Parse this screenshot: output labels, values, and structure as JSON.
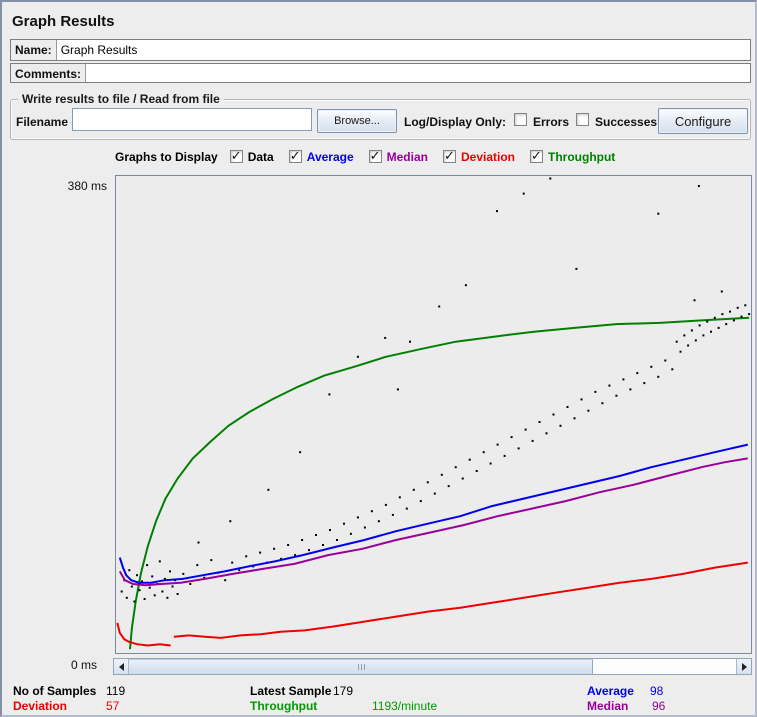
{
  "window": {
    "title": "Graph Results"
  },
  "name_field": {
    "label": "Name:",
    "value": "Graph Results"
  },
  "comments_field": {
    "label": "Comments:",
    "value": ""
  },
  "file_section": {
    "title": "Write results to file / Read from file",
    "filename_label": "Filename",
    "filename_value": "",
    "browse_label": "Browse...",
    "log_display_label": "Log/Display Only:",
    "errors_label": "Errors",
    "errors_checked": false,
    "successes_label": "Successes",
    "successes_checked": false,
    "configure_label": "Configure"
  },
  "graphs_to_display": {
    "label": "Graphs to Display",
    "items": [
      {
        "label": "Data",
        "color": "#000000",
        "checked": true
      },
      {
        "label": "Average",
        "color": "#0000ee",
        "checked": true
      },
      {
        "label": "Median",
        "color": "#990099",
        "checked": true
      },
      {
        "label": "Deviation",
        "color": "#ee0000",
        "checked": true
      },
      {
        "label": "Throughput",
        "color": "#008000",
        "checked": true
      }
    ]
  },
  "chart_data": {
    "type": "scatter+line",
    "y_unit": "ms",
    "ylim": [
      0,
      380
    ],
    "axis_labels": {
      "top": "380 ms",
      "bottom": "0 ms"
    },
    "plot_bg": "#ececec",
    "series": [
      {
        "name": "Throughput",
        "color": "#008000",
        "width": 2,
        "segments": [
          [
            [
              2.2,
              3
            ],
            [
              2.5,
              20
            ],
            [
              3.1,
              41
            ],
            [
              3.9,
              63
            ],
            [
              5.0,
              85
            ],
            [
              6.3,
              105
            ],
            [
              7.8,
              123
            ],
            [
              9.7,
              139
            ],
            [
              12.1,
              155
            ],
            [
              14.8,
              168
            ],
            [
              17.7,
              181
            ],
            [
              21.0,
              192
            ],
            [
              24.6,
              202
            ],
            [
              28.6,
              212
            ],
            [
              32.8,
              221
            ],
            [
              37.5,
              228
            ],
            [
              42.5,
              236
            ],
            [
              47.9,
              242
            ],
            [
              53.5,
              248
            ],
            [
              59.5,
              252
            ],
            [
              65.8,
              256
            ],
            [
              72.2,
              259
            ],
            [
              78.8,
              262
            ],
            [
              85.6,
              263
            ],
            [
              92.2,
              265
            ],
            [
              99.7,
              267
            ]
          ]
        ]
      },
      {
        "name": "Deviation",
        "color": "#ee0000",
        "width": 2,
        "segments": [
          [
            [
              0.2,
              24
            ],
            [
              0.6,
              16
            ],
            [
              1.3,
              11
            ],
            [
              2.0,
              9
            ],
            [
              3.3,
              7
            ],
            [
              5.0,
              6
            ],
            [
              6.9,
              7
            ],
            [
              8.6,
              6
            ]
          ],
          [
            [
              9.1,
              13
            ],
            [
              11.5,
              14
            ],
            [
              14.0,
              13
            ],
            [
              16.5,
              12
            ],
            [
              19.6,
              14
            ],
            [
              22.8,
              15
            ],
            [
              25.9,
              17
            ],
            [
              29.7,
              18
            ],
            [
              34.1,
              21
            ],
            [
              39.1,
              25
            ],
            [
              44.1,
              29
            ],
            [
              49.1,
              33
            ],
            [
              54.2,
              36
            ],
            [
              59.2,
              40
            ],
            [
              64.2,
              44
            ],
            [
              69.2,
              48
            ],
            [
              74.3,
              52
            ],
            [
              79.3,
              56
            ],
            [
              84.3,
              59
            ],
            [
              89.3,
              63
            ],
            [
              94.3,
              68
            ],
            [
              99.5,
              72
            ]
          ]
        ]
      },
      {
        "name": "Median",
        "color": "#990099",
        "width": 2,
        "segments": [
          [
            [
              0.6,
              65
            ],
            [
              1.4,
              58
            ],
            [
              2.7,
              55
            ],
            [
              4.6,
              54
            ],
            [
              7.1,
              55
            ],
            [
              10.2,
              56
            ],
            [
              14.0,
              59
            ],
            [
              18.4,
              63
            ],
            [
              23.1,
              67
            ],
            [
              28.1,
              71
            ],
            [
              33.4,
              78
            ],
            [
              38.8,
              83
            ],
            [
              44.1,
              90
            ],
            [
              49.5,
              96
            ],
            [
              54.8,
              102
            ],
            [
              60.1,
              109
            ],
            [
              65.5,
              115
            ],
            [
              70.8,
              121
            ],
            [
              76.1,
              128
            ],
            [
              81.5,
              134
            ],
            [
              86.8,
              141
            ],
            [
              92.2,
              148
            ],
            [
              95.9,
              152
            ],
            [
              99.5,
              155
            ]
          ]
        ]
      },
      {
        "name": "Average",
        "color": "#0000ee",
        "width": 2,
        "segments": [
          [
            [
              0.6,
              76
            ],
            [
              1.1,
              68
            ],
            [
              1.6,
              62
            ],
            [
              2.4,
              58
            ],
            [
              3.6,
              56
            ],
            [
              5.5,
              56
            ],
            [
              7.7,
              58
            ],
            [
              10.5,
              59
            ],
            [
              13.7,
              62
            ],
            [
              17.1,
              65
            ],
            [
              20.9,
              69
            ],
            [
              25.0,
              73
            ],
            [
              29.4,
              78
            ],
            [
              34.1,
              84
            ],
            [
              39.1,
              90
            ],
            [
              44.1,
              97
            ],
            [
              49.1,
              103
            ],
            [
              54.2,
              109
            ],
            [
              59.2,
              117
            ],
            [
              64.2,
              123
            ],
            [
              69.2,
              129
            ],
            [
              74.3,
              135
            ],
            [
              79.3,
              141
            ],
            [
              84.3,
              148
            ],
            [
              89.3,
              154
            ],
            [
              94.3,
              160
            ],
            [
              99.5,
              166
            ]
          ]
        ]
      }
    ],
    "scatter_series": {
      "name": "Data",
      "color": "#000000",
      "dot_size": 2,
      "points": [
        [
          0.9,
          49
        ],
        [
          1.3,
          58
        ],
        [
          1.7,
          44
        ],
        [
          2.1,
          66
        ],
        [
          2.5,
          53
        ],
        [
          2.9,
          41
        ],
        [
          3.3,
          62
        ],
        [
          3.7,
          50
        ],
        [
          4.1,
          57
        ],
        [
          4.5,
          43
        ],
        [
          4.9,
          70
        ],
        [
          5.3,
          52
        ],
        [
          5.7,
          61
        ],
        [
          6.1,
          46
        ],
        [
          6.5,
          55
        ],
        [
          6.9,
          73
        ],
        [
          7.3,
          49
        ],
        [
          7.7,
          59
        ],
        [
          8.1,
          44
        ],
        [
          8.5,
          65
        ],
        [
          8.9,
          53
        ],
        [
          9.3,
          58
        ],
        [
          9.7,
          47
        ],
        [
          10.6,
          63
        ],
        [
          11.7,
          55
        ],
        [
          12.8,
          70
        ],
        [
          13.9,
          60
        ],
        [
          15.0,
          74
        ],
        [
          16.1,
          64
        ],
        [
          17.2,
          58
        ],
        [
          18.3,
          72
        ],
        [
          19.4,
          66
        ],
        [
          20.5,
          77
        ],
        [
          21.6,
          69
        ],
        [
          22.7,
          80
        ],
        [
          23.8,
          72
        ],
        [
          24.9,
          83
        ],
        [
          26.0,
          75
        ],
        [
          27.1,
          86
        ],
        [
          28.2,
          78
        ],
        [
          29.3,
          90
        ],
        [
          30.4,
          82
        ],
        [
          31.5,
          94
        ],
        [
          32.6,
          86
        ],
        [
          33.7,
          98
        ],
        [
          34.8,
          90
        ],
        [
          35.9,
          103
        ],
        [
          37.0,
          95
        ],
        [
          38.1,
          108
        ],
        [
          39.2,
          100
        ],
        [
          40.3,
          113
        ],
        [
          41.4,
          105
        ],
        [
          42.5,
          118
        ],
        [
          43.6,
          110
        ],
        [
          44.7,
          124
        ],
        [
          45.8,
          115
        ],
        [
          46.9,
          130
        ],
        [
          48.0,
          121
        ],
        [
          49.1,
          136
        ],
        [
          50.2,
          127
        ],
        [
          51.3,
          142
        ],
        [
          52.4,
          133
        ],
        [
          53.5,
          148
        ],
        [
          54.6,
          139
        ],
        [
          55.7,
          154
        ],
        [
          56.8,
          145
        ],
        [
          57.9,
          160
        ],
        [
          59.0,
          151
        ],
        [
          60.1,
          166
        ],
        [
          61.2,
          157
        ],
        [
          62.3,
          172
        ],
        [
          63.4,
          163
        ],
        [
          64.5,
          178
        ],
        [
          65.6,
          169
        ],
        [
          66.7,
          184
        ],
        [
          67.8,
          175
        ],
        [
          68.9,
          190
        ],
        [
          70.0,
          181
        ],
        [
          71.1,
          196
        ],
        [
          72.2,
          187
        ],
        [
          73.3,
          202
        ],
        [
          74.4,
          193
        ],
        [
          75.5,
          208
        ],
        [
          76.6,
          199
        ],
        [
          77.7,
          213
        ],
        [
          78.8,
          205
        ],
        [
          79.9,
          218
        ],
        [
          81.0,
          210
        ],
        [
          82.1,
          223
        ],
        [
          83.2,
          215
        ],
        [
          84.3,
          228
        ],
        [
          85.4,
          220
        ],
        [
          86.5,
          233
        ],
        [
          87.6,
          226
        ],
        [
          88.3,
          248
        ],
        [
          88.9,
          240
        ],
        [
          89.5,
          253
        ],
        [
          90.1,
          245
        ],
        [
          90.7,
          257
        ],
        [
          91.3,
          249
        ],
        [
          91.9,
          261
        ],
        [
          92.5,
          253
        ],
        [
          93.1,
          264
        ],
        [
          93.7,
          256
        ],
        [
          94.3,
          267
        ],
        [
          94.9,
          259
        ],
        [
          95.5,
          270
        ],
        [
          96.1,
          262
        ],
        [
          96.7,
          272
        ],
        [
          97.3,
          265
        ],
        [
          97.9,
          275
        ],
        [
          98.5,
          268
        ],
        [
          99.1,
          277
        ],
        [
          99.7,
          270
        ],
        [
          68.4,
          378
        ],
        [
          64.2,
          366
        ],
        [
          60.0,
          352
        ],
        [
          85.4,
          350
        ],
        [
          91.8,
          372
        ],
        [
          72.5,
          306
        ],
        [
          55.1,
          293
        ],
        [
          95.4,
          288
        ],
        [
          91.1,
          281
        ],
        [
          42.4,
          251
        ],
        [
          46.3,
          248
        ],
        [
          38.1,
          236
        ],
        [
          33.6,
          206
        ],
        [
          44.4,
          210
        ],
        [
          50.9,
          276
        ],
        [
          29.0,
          160
        ],
        [
          24.0,
          130
        ],
        [
          18.0,
          105
        ],
        [
          13.0,
          88
        ]
      ]
    }
  },
  "stats": {
    "no_samples": {
      "label": "No of Samples",
      "value": "119",
      "color": "#000000"
    },
    "latest_sample": {
      "label": "Latest Sample",
      "value": "179",
      "color": "#000000"
    },
    "average": {
      "label": "Average",
      "value": "98",
      "color": "#0000ee"
    },
    "deviation": {
      "label": "Deviation",
      "value": "57",
      "color": "#ee0000"
    },
    "throughput": {
      "label": "Throughput",
      "value": "1193/minute",
      "color": "#009900"
    },
    "median": {
      "label": "Median",
      "value": "96",
      "color": "#990099"
    }
  }
}
